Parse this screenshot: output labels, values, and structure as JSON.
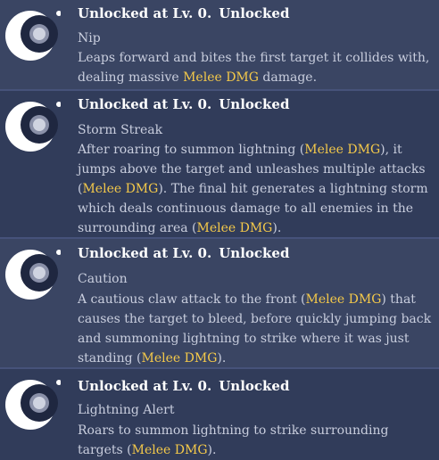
{
  "skills": [
    {
      "unlock": "Unlocked at Lv. 0.",
      "status": "Unlocked",
      "name": "Nip",
      "desc": [
        "Leaps forward and bites the first target it collides with, dealing massive ",
        "Melee DMG",
        " damage."
      ]
    },
    {
      "unlock": "Unlocked at Lv. 0.",
      "status": "Unlocked",
      "name": "Storm Streak",
      "desc": [
        "After roaring to summon lightning (",
        "Melee DMG",
        "), it jumps above the target and unleashes multiple attacks (",
        "Melee DMG",
        "). The final hit generates a lightning storm which deals continuous damage to all enemies in the surrounding area (",
        "Melee DMG",
        ")."
      ]
    },
    {
      "unlock": "Unlocked at Lv. 0.",
      "status": "Unlocked",
      "name": "Caution",
      "desc": [
        "A cautious claw attack to the front (",
        "Melee DMG",
        ") that causes the target to bleed, before quickly jumping back and summoning lightning to strike where it was just standing (",
        "Melee DMG",
        ")."
      ]
    },
    {
      "unlock": "Unlocked at Lv. 0.",
      "status": "Unlocked",
      "name": "Lightning Alert",
      "desc": [
        "Roars to summon lightning to strike surrounding targets (",
        "Melee DMG",
        ")."
      ]
    }
  ],
  "icon": "crescent-moon-icon",
  "colors": {
    "highlight": "#f4c94a",
    "text": "#c9cede",
    "heading": "#ffffff"
  }
}
